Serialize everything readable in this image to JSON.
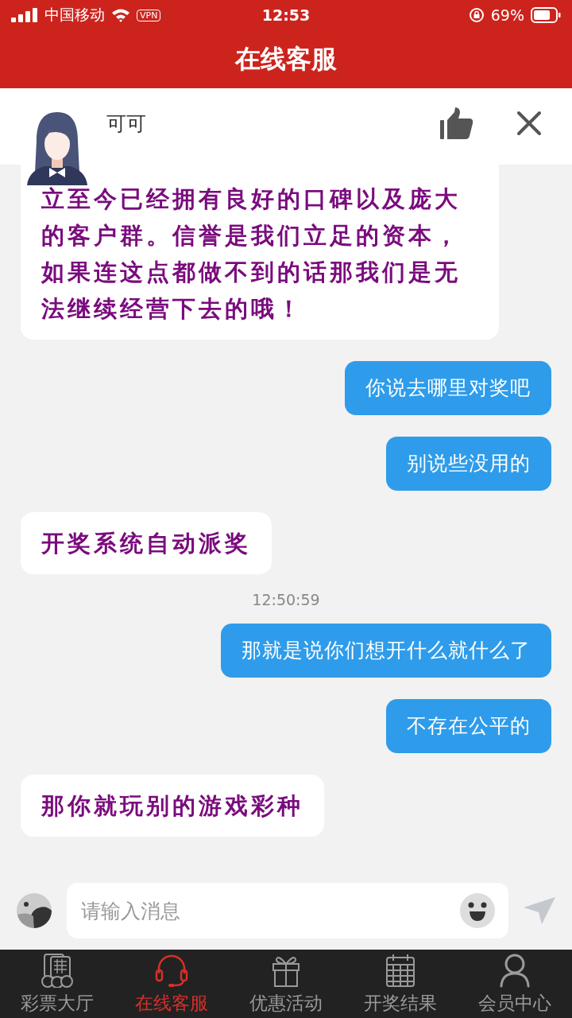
{
  "status_bar": {
    "carrier": "中国移动",
    "vpn": "VPN",
    "time": "12:53",
    "battery": "69%"
  },
  "header": {
    "title": "在线客服"
  },
  "agent": {
    "name": "可可"
  },
  "messages": [
    {
      "kind": "agent",
      "text": "立至今已经拥有良好的口碑以及庞大的客户群。信誉是我们立足的资本，如果连这点都做不到的话那我们是无法继续经营下去的哦！"
    },
    {
      "kind": "user",
      "text": "你说去哪里对奖吧"
    },
    {
      "kind": "user",
      "text": "别说些没用的"
    },
    {
      "kind": "agent",
      "text": "开奖系统自动派奖"
    },
    {
      "kind": "time",
      "text": "12:50:59"
    },
    {
      "kind": "user",
      "text": "那就是说你们想开什么就什么了"
    },
    {
      "kind": "user",
      "text": "不存在公平的"
    },
    {
      "kind": "agent",
      "text": "那你就玩别的游戏彩种"
    }
  ],
  "input": {
    "placeholder": "请输入消息"
  },
  "tabs": [
    {
      "label": "彩票大厅",
      "selected": false
    },
    {
      "label": "在线客服",
      "selected": true
    },
    {
      "label": "优惠活动",
      "selected": false
    },
    {
      "label": "开奖结果",
      "selected": false
    },
    {
      "label": "会员中心",
      "selected": false
    }
  ]
}
